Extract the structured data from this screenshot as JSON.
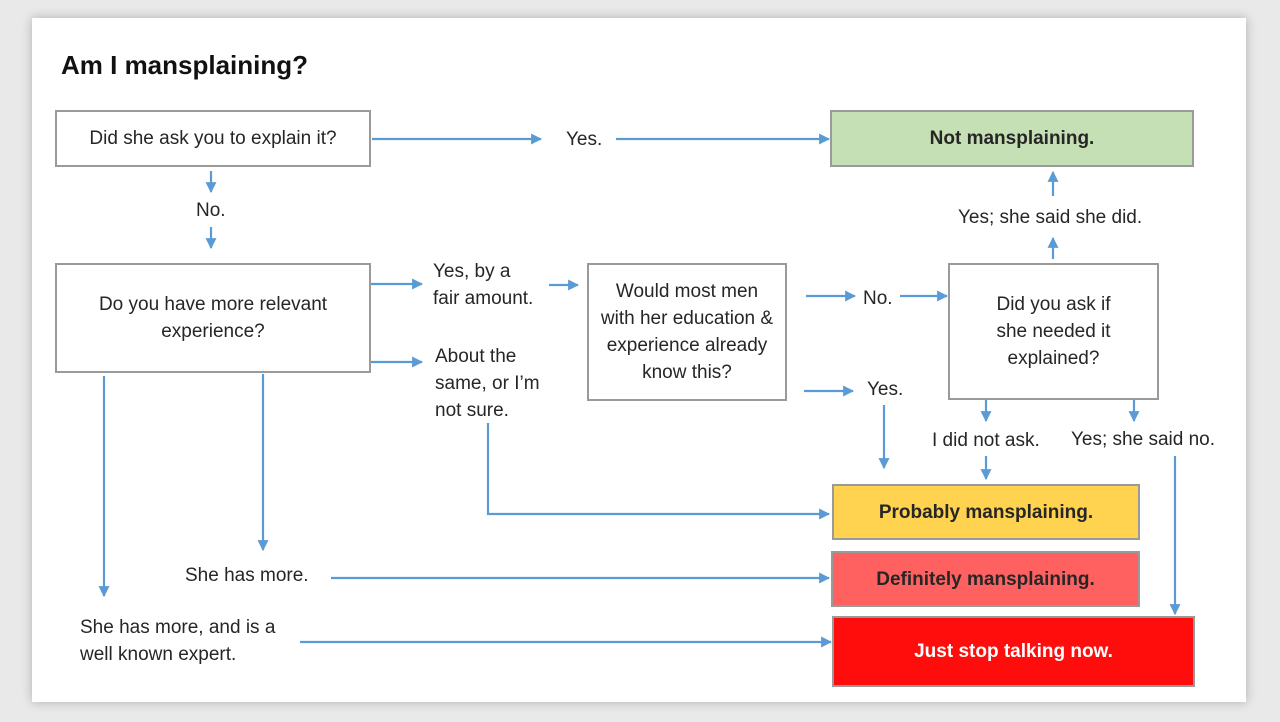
{
  "title": "Am I mansplaining?",
  "nodes": {
    "q_asked": "Did she ask you to explain it?",
    "q_experience": "Do you have more relevant experience?",
    "q_most_men": "Would most men with her education & experience already know this?",
    "q_did_you_ask": "Did you ask if she needed it explained?"
  },
  "outcomes": {
    "not": "Not mansplaining.",
    "probably": "Probably mansplaining.",
    "definitely": "Definitely mansplaining.",
    "stop": "Just stop talking now."
  },
  "edge_labels": {
    "asked_yes": "Yes.",
    "asked_no": "No.",
    "exp_yes_fair": "Yes, by a\nfair amount.",
    "exp_same": "About the\nsame, or I’m\nnot sure.",
    "exp_she_more": "She has more.",
    "exp_she_expert": "She has more, and is a\nwell known expert.",
    "men_no": "No.",
    "men_yes": "Yes.",
    "ask_said_did": "Yes; she said she did.",
    "ask_did_not": "I did not ask.",
    "ask_said_no": "Yes; she said no."
  },
  "colors": {
    "arrow": "#5b9bd5",
    "not": "#c5e0b4",
    "probably": "#ffd24f",
    "definitely": "#ff6161",
    "stop": "#ff0d0d",
    "box_border": "#9a9a9a"
  }
}
